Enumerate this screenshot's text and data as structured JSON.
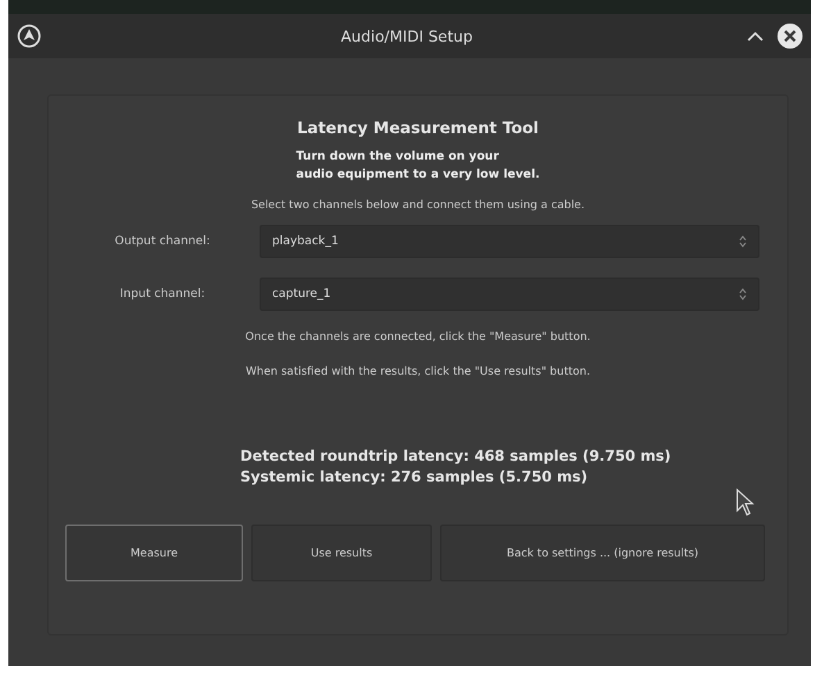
{
  "window": {
    "title": "Audio/MIDI Setup"
  },
  "tool": {
    "title": "Latency Measurement Tool",
    "warning": [
      "Turn down the volume on your",
      "audio equipment to a very low level."
    ],
    "instruction": "Select two channels below and connect them using a cable.",
    "fields": [
      {
        "label": "Output channel:",
        "value": "playback_1"
      },
      {
        "label": "Input channel:",
        "value": "capture_1"
      }
    ],
    "hints": [
      "Once the channels are connected, click the \"Measure\" button.",
      "When satisfied with the results, click the \"Use results\" button."
    ],
    "results": [
      "Detected roundtrip latency: 468 samples (9.750 ms)",
      "Systemic latency: 276 samples (5.750 ms)"
    ],
    "buttons": [
      {
        "label": "Measure",
        "focused": true
      },
      {
        "label": "Use results",
        "focused": false
      },
      {
        "label": "Back to settings ... (ignore results)",
        "focused": false
      }
    ]
  }
}
